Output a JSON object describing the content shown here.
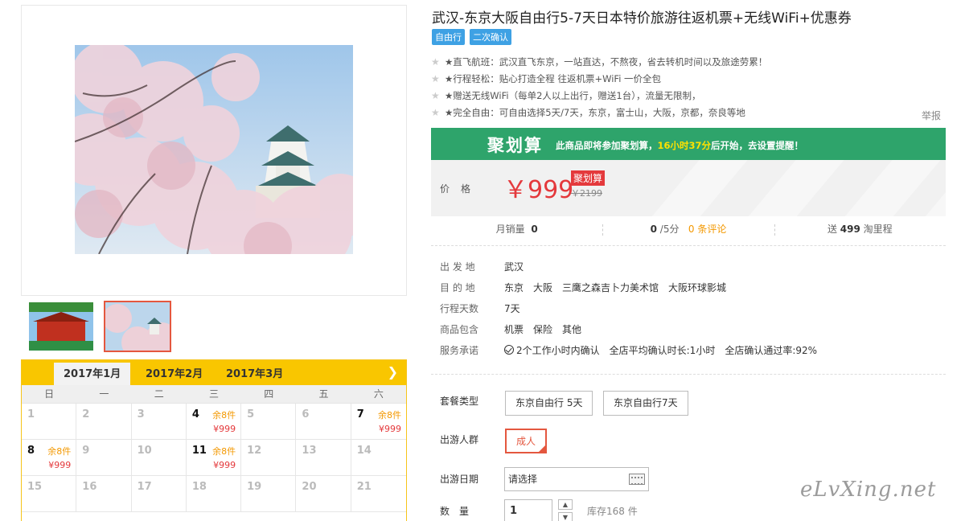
{
  "product": {
    "title": "武汉-东京大阪自由行5-7天日本特价旅游往返机票+无线WiFi+优惠券",
    "tags": [
      "自由行",
      "二次确认"
    ],
    "features": [
      "★直飞航班：武汉直飞东京，一站直达，不熬夜，省去转机时间以及旅途劳累！",
      "★行程轻松：贴心打造全程 往返机票+WiFi 一价全包",
      "★赠送无线WiFi（每单2人以上出行，赠送1台），流量无限制，",
      "★完全自由：可自由选择5天/7天，东京，富士山，大阪，京都，奈良等地"
    ],
    "report_label": "举报"
  },
  "juhuasuan": {
    "logo": "聚划算",
    "text_before": "此商品即将参加聚划算，",
    "time": "16小时37分",
    "text_after": "后开始，去设置提醒！"
  },
  "price": {
    "label": "价格",
    "value": "￥999",
    "badge": "聚划算",
    "original": "￥2199"
  },
  "stats": {
    "monthly_sales_label": "月销量",
    "monthly_sales": "0",
    "rating": "0",
    "rating_suffix": "/5分",
    "reviews": "0 条评论",
    "points_prefix": "送",
    "points": "499",
    "points_suffix": "淘里程"
  },
  "info": [
    {
      "label": "出 发 地",
      "values": [
        "武汉"
      ]
    },
    {
      "label": "目 的 地",
      "values": [
        "东京",
        "大阪",
        "三鹰之森吉卜力美术馆",
        "大阪环球影城"
      ]
    },
    {
      "label": "行程天数",
      "values": [
        "7天"
      ]
    },
    {
      "label": "商品包含",
      "values": [
        "机票",
        "保险",
        "其他"
      ]
    },
    {
      "label": "服务承诺",
      "values": [
        "2个工作小时内确认",
        "全店平均确认时长:1小时",
        "全店确认通过率:92%"
      ]
    }
  ],
  "options": {
    "package_label": "套餐类型",
    "packages": [
      "东京自由行 5天",
      "东京自由行7天"
    ],
    "traveler_label": "出游人群",
    "traveler": "成人",
    "date_label": "出游日期",
    "date_placeholder": "请选择",
    "qty_label": "数　量",
    "qty_value": "1",
    "stock": "库存168 件"
  },
  "calendar": {
    "tabs": [
      "2017年1月",
      "2017年2月",
      "2017年3月"
    ],
    "active_tab": 0,
    "next_icon": "chevron-right-icon",
    "weekdays": [
      "日",
      "一",
      "二",
      "三",
      "四",
      "五",
      "六"
    ],
    "cells": [
      {
        "day": "1"
      },
      {
        "day": "2"
      },
      {
        "day": "3"
      },
      {
        "day": "4",
        "stock": "余8件",
        "price": "¥999"
      },
      {
        "day": "5"
      },
      {
        "day": "6"
      },
      {
        "day": "7",
        "stock": "余8件",
        "price": "¥999"
      },
      {
        "day": "8",
        "stock": "余8件",
        "price": "¥999"
      },
      {
        "day": "9"
      },
      {
        "day": "10"
      },
      {
        "day": "11",
        "stock": "余8件",
        "price": "¥999"
      },
      {
        "day": "12"
      },
      {
        "day": "13"
      },
      {
        "day": "14"
      },
      {
        "day": "15"
      },
      {
        "day": "16"
      },
      {
        "day": "17"
      },
      {
        "day": "18"
      },
      {
        "day": "19"
      },
      {
        "day": "20"
      },
      {
        "day": "21"
      }
    ]
  },
  "watermark": "eLvXing.net"
}
